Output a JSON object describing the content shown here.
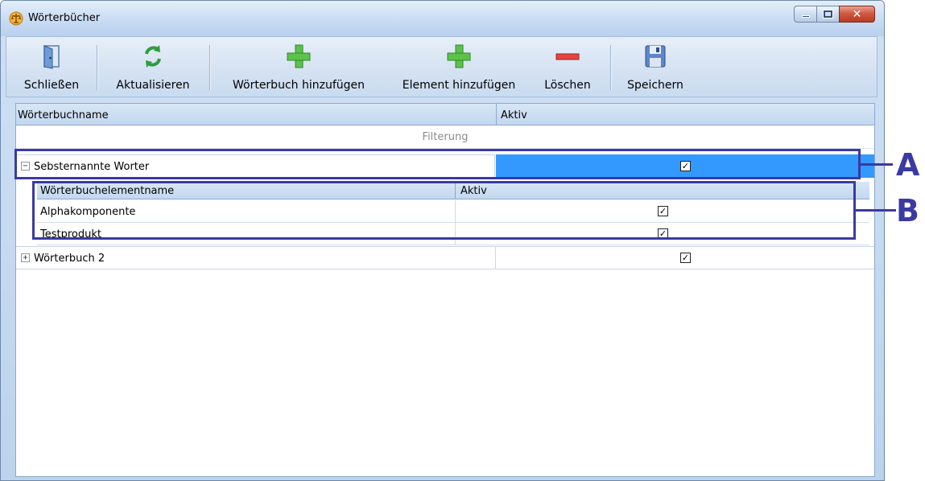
{
  "window": {
    "title": "Wörterbücher"
  },
  "toolbar": {
    "buttons": [
      {
        "label": "Schließen",
        "icon": "door-exit-icon"
      },
      {
        "label": "Aktualisieren",
        "icon": "refresh-icon"
      },
      {
        "label": "Wörterbuch hinzufügen",
        "icon": "plus-icon"
      },
      {
        "label": "Element hinzufügen",
        "icon": "plus-icon"
      },
      {
        "label": "Löschen",
        "icon": "minus-icon"
      },
      {
        "label": "Speichern",
        "icon": "floppy-save-icon"
      }
    ]
  },
  "grid": {
    "columns": [
      "Wörterbuchname",
      "Aktiv"
    ],
    "filter_text": "Filterung",
    "rows": [
      {
        "name": "Sebsternannte Worter",
        "active": true,
        "expanded": true,
        "sub_columns": [
          "Wörterbuchelementname",
          "Aktiv"
        ],
        "children": [
          {
            "name": "Alphakomponente",
            "active": true
          },
          {
            "name": "Testprodukt",
            "active": true
          }
        ]
      },
      {
        "name": "Wörterbuch 2",
        "active": true,
        "expanded": false
      }
    ]
  },
  "annotations": {
    "a": "A",
    "b": "B"
  },
  "colors": {
    "selected": "#3399ff",
    "annotation": "#3b3aa3"
  }
}
